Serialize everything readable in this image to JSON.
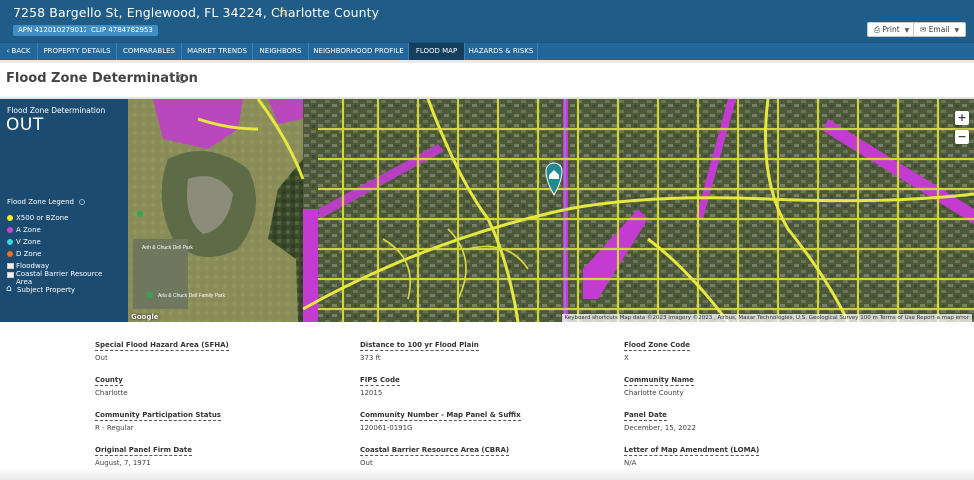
{
  "header": {
    "address": "7258 Bargello St, Englewood, FL 34224, Charlotte County",
    "apn": "APN 412010279012",
    "clip": "CLIP 4784782953",
    "print_label": "Print",
    "email_label": "Email"
  },
  "tabs": [
    {
      "label": "BACK"
    },
    {
      "label": "PROPERTY DETAILS"
    },
    {
      "label": "COMPARABLES"
    },
    {
      "label": "MARKET TRENDS"
    },
    {
      "label": "NEIGHBORS"
    },
    {
      "label": "NEIGHBORHOOD PROFILE"
    },
    {
      "label": "FLOOD MAP"
    },
    {
      "label": "HAZARDS & RISKS"
    }
  ],
  "page_title": "Flood Zone Determination",
  "panel": {
    "title": "Flood Zone Determination",
    "status": "OUT",
    "legend_title": "Flood Zone Legend",
    "legend": [
      {
        "label": "X500 or BZone",
        "color": "#f1ef2c"
      },
      {
        "label": "A Zone",
        "color": "#d23fd8"
      },
      {
        "label": "V Zone",
        "color": "#35d6e0"
      },
      {
        "label": "D Zone",
        "color": "#f06a2a"
      },
      {
        "label": "Floodway"
      },
      {
        "label": "Coastal Barrier Resource Area"
      },
      {
        "label": "Subject Property"
      }
    ]
  },
  "map": {
    "attribution": "Keyboard shortcuts   Map data ©2023 Imagery ©2023 , Airbus, Maxar Technologies, U.S. Geological Survey   100 m        Terms of Use   Report a map error",
    "logo": "Google",
    "zoom_in": "+",
    "zoom_out": "−",
    "labels": [
      "Arla & Chuck Dell Family Park",
      "Anh & Chuck Dell Park"
    ]
  },
  "details": [
    {
      "label": "Special Flood Hazard Area (SFHA)",
      "value": "Out"
    },
    {
      "label": "Distance to 100 yr Flood Plain",
      "value": "373 ft"
    },
    {
      "label": "Flood Zone Code",
      "value": "X"
    },
    {
      "label": "County",
      "value": "Charlotte"
    },
    {
      "label": "FIPS Code",
      "value": "12015"
    },
    {
      "label": "Community Name",
      "value": "Charlotte County"
    },
    {
      "label": "Community Participation Status",
      "value": "R - Regular"
    },
    {
      "label": "Community Number - Map Panel & Suffix",
      "value": "120061-0191G"
    },
    {
      "label": "Panel Date",
      "value": "December, 15, 2022"
    },
    {
      "label": "Original Panel Firm Date",
      "value": "August, 7, 1971"
    },
    {
      "label": "Coastal Barrier Resource Area (CBRA)",
      "value": "Out"
    },
    {
      "label": "Letter of Map Amendment (LOMA)",
      "value": "N/A"
    }
  ]
}
